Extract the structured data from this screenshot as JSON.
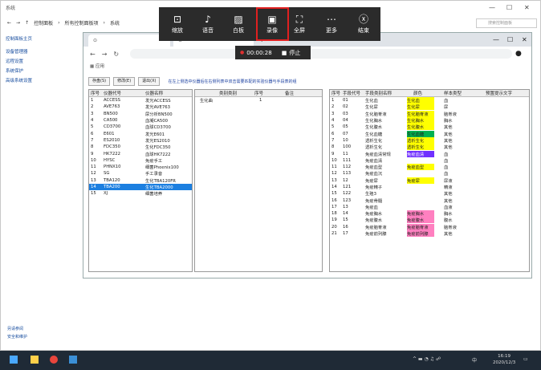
{
  "outer": {
    "title": "系统",
    "breadcrumb": [
      "控制面板",
      "所有控制面板项",
      "系统"
    ],
    "search_placeholder": "搜索控制面板",
    "left_nav": [
      "控制面板主页",
      "设备管理器",
      "远程设置",
      "系统保护",
      "高级系统设置"
    ],
    "footer_links": [
      "另请参阅",
      "安全和维护"
    ]
  },
  "recorder": {
    "buttons": [
      {
        "label": "缩放",
        "icon": "zoom-icon"
      },
      {
        "label": "语音",
        "icon": "microphone-icon"
      },
      {
        "label": "白板",
        "icon": "whiteboard-icon"
      },
      {
        "label": "录像",
        "icon": "record-icon"
      },
      {
        "label": "全屏",
        "icon": "fullscreen-icon"
      },
      {
        "label": "更多",
        "icon": "more-icon"
      },
      {
        "label": "结束",
        "icon": "close-icon"
      }
    ],
    "timer": "00:00:28",
    "stop_label": "停止"
  },
  "browser": {
    "bookmarks_label": "应用",
    "toolbar": {
      "save": "存盘(S)",
      "edit": "修改(E)",
      "exit": "退出(X)"
    },
    "hint": "在左上侧选中仪器后在右侧列表中双击需要匹配的实验仪器与手段表的组",
    "left_pane": {
      "headers": [
        "序号",
        "仪器代号",
        "仪器名称"
      ],
      "rows": [
        [
          "1",
          "ACCESS",
          "发光ACCESS"
        ],
        [
          "2",
          "AVE763",
          "发光AVE763"
        ],
        [
          "3",
          "BN500",
          "尿分析BN500"
        ],
        [
          "4",
          "CA500",
          "血凝CA500"
        ],
        [
          "5",
          "CD3700",
          "血球CD3700"
        ],
        [
          "6",
          "E601",
          "发光E601"
        ],
        [
          "7",
          "ES2010",
          "发光ES2010"
        ],
        [
          "8",
          "FDC350",
          "生化FDC350"
        ],
        [
          "9",
          "HK7222",
          "血球HK7222"
        ],
        [
          "10",
          "HYSC",
          "免疫手工"
        ],
        [
          "11",
          "PHNX10",
          "细菌Phoenix100"
        ],
        [
          "12",
          "SG",
          "手工录音"
        ],
        [
          "13",
          "TBA120",
          "生化TBA120FR"
        ],
        [
          "14",
          "TBA200",
          "生化TBA2000"
        ],
        [
          "15",
          "XJ",
          "细菌培养"
        ]
      ],
      "selected_index": 13
    },
    "mid_pane": {
      "headers": [
        "类别类别",
        "序号",
        "备注"
      ],
      "rows": [
        [
          "生化曲",
          "1",
          ""
        ]
      ]
    },
    "right_pane": {
      "headers": [
        "序号",
        "手段代号",
        "手段类别名称",
        "颜色",
        "样本类型",
        "预置提示文字"
      ],
      "rows": [
        [
          "1",
          "01",
          "生化血",
          "生化血",
          "血",
          ""
        ],
        [
          "2",
          "02",
          "生化尿",
          "生化尿",
          "尿",
          ""
        ],
        [
          "3",
          "03",
          "生化脑脊液",
          "生化脑脊液",
          "脑脊液",
          ""
        ],
        [
          "4",
          "04",
          "生化胸水",
          "生化胸水",
          "胸水",
          ""
        ],
        [
          "5",
          "05",
          "生化腹水",
          "生化腹水",
          "其他",
          ""
        ],
        [
          "6",
          "07",
          "生化血糖",
          "生化血糖",
          "其他",
          ""
        ],
        [
          "7",
          "10",
          "透析生化",
          "透析生化",
          "其他",
          ""
        ],
        [
          "8",
          "100",
          "透析生化",
          "透析生化",
          "其他",
          ""
        ],
        [
          "9",
          "11",
          "免疫血清常规",
          "免疫血清",
          "血",
          ""
        ],
        [
          "10",
          "111",
          "免疫血清",
          "",
          "血",
          ""
        ],
        [
          "11",
          "112",
          "免疫血型",
          "免疫血型",
          "血",
          ""
        ],
        [
          "12",
          "113",
          "免疫血沉",
          "",
          "血",
          ""
        ],
        [
          "13",
          "12",
          "免疫尿",
          "免疫尿",
          "尿液",
          ""
        ],
        [
          "14",
          "121",
          "免疫精子",
          "",
          "精液",
          ""
        ],
        [
          "15",
          "122",
          "生殖3",
          "",
          "其他",
          ""
        ],
        [
          "16",
          "123",
          "免疫骨髓",
          "",
          "其他",
          ""
        ],
        [
          "17",
          "13",
          "免疫血",
          "",
          "血液",
          ""
        ],
        [
          "18",
          "14",
          "免疫胸水",
          "免疫胸水",
          "胸水",
          ""
        ],
        [
          "19",
          "15",
          "免疫腹水",
          "免疫腹水",
          "腹水",
          ""
        ],
        [
          "20",
          "16",
          "免疫脑脊液",
          "免疫脑脊液",
          "脑脊液",
          ""
        ],
        [
          "21",
          "17",
          "免疫前列腺",
          "免疫前列腺",
          "其他",
          ""
        ]
      ],
      "colors": [
        "#ffff00",
        "#ffff00",
        "#ffff00",
        "#ffff00",
        "#ffff00",
        "#00b050",
        "#ffff00",
        "#ffff00",
        "#7030ff",
        "#2060ff",
        "#ffff00",
        "#000000",
        "#ffff00",
        "#ff3030",
        "#ff0000",
        "#ff80c0",
        "#2060ff",
        "#ff80c0",
        "#ff80c0",
        "#ff80c0",
        "#ff80c0"
      ]
    }
  },
  "taskbar": {
    "time": "16:19",
    "date": "2020/12/3",
    "lang": "中"
  }
}
